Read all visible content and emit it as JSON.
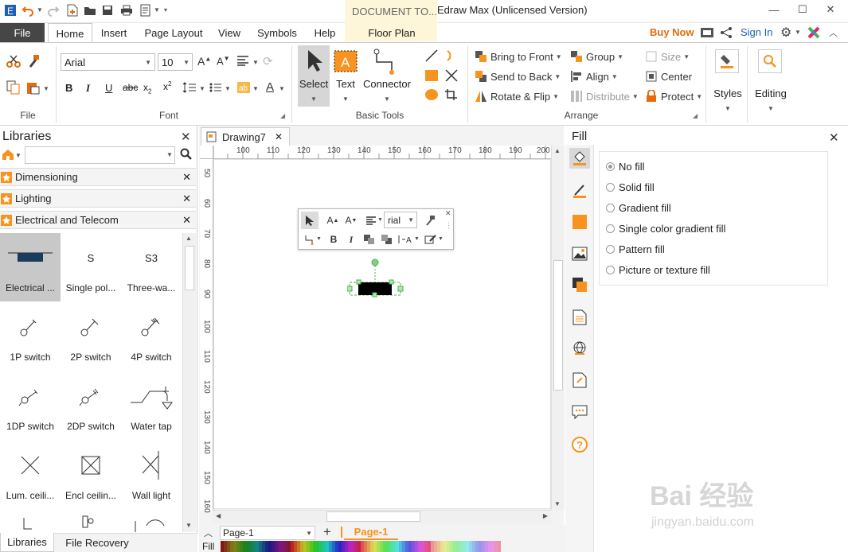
{
  "window": {
    "title": "Edraw Max (Unlicensed Version)",
    "context_tab": "DOCUMENT TO...",
    "controls": {
      "minimize": "—",
      "maximize": "☐",
      "close": "✕"
    }
  },
  "menu": {
    "file_tab": "File",
    "tabs": [
      "Home",
      "Insert",
      "Page Layout",
      "View",
      "Symbols",
      "Help",
      "Floor Plan"
    ],
    "buy_now": "Buy Now",
    "sign_in": "Sign In"
  },
  "ribbon": {
    "groups": {
      "file": "File",
      "font": "Font",
      "basic_tools": "Basic Tools",
      "arrange": "Arrange"
    },
    "font_name": "Arial",
    "font_size": "10",
    "tools": {
      "select": "Select",
      "text": "Text",
      "connector": "Connector"
    },
    "arrange": {
      "bring_to_front": "Bring to Front",
      "send_to_back": "Send to Back",
      "rotate_flip": "Rotate & Flip",
      "group": "Group",
      "align": "Align",
      "distribute": "Distribute",
      "size": "Size",
      "center": "Center",
      "protect": "Protect"
    },
    "styles": "Styles",
    "editing": "Editing"
  },
  "libraries": {
    "title": "Libraries",
    "search_value": "",
    "categories": [
      "Dimensioning",
      "Lighting",
      "Electrical and Telecom"
    ],
    "shapes": [
      {
        "label": "Electrical ...",
        "icon": "electrical-panel-icon",
        "glyph": ""
      },
      {
        "label": "Single pol...",
        "icon": "single-pole-icon",
        "glyph": "S"
      },
      {
        "label": "Three-wa...",
        "icon": "three-way-icon",
        "glyph": "S3"
      },
      {
        "label": "1P switch",
        "icon": "1p-switch-icon",
        "glyph": ""
      },
      {
        "label": "2P switch",
        "icon": "2p-switch-icon",
        "glyph": ""
      },
      {
        "label": "4P switch",
        "icon": "4p-switch-icon",
        "glyph": ""
      },
      {
        "label": "1DP switch",
        "icon": "1dp-switch-icon",
        "glyph": ""
      },
      {
        "label": "2DP switch",
        "icon": "2dp-switch-icon",
        "glyph": ""
      },
      {
        "label": "Water tap",
        "icon": "water-tap-icon",
        "glyph": ""
      },
      {
        "label": "Lum. ceili...",
        "icon": "lum-ceiling-icon",
        "glyph": ""
      },
      {
        "label": "Encl ceilin...",
        "icon": "encl-ceiling-icon",
        "glyph": ""
      },
      {
        "label": "Wall light",
        "icon": "wall-light-icon",
        "glyph": ""
      }
    ],
    "bottom_tabs": [
      "Libraries",
      "File Recovery"
    ]
  },
  "document": {
    "tab_name": "Drawing7",
    "ruler_h": [
      "100",
      "110",
      "120",
      "130",
      "140",
      "150",
      "160",
      "170",
      "180",
      "190",
      "200"
    ],
    "ruler_v": [
      "50",
      "60",
      "70",
      "80",
      "90",
      "100",
      "110",
      "120",
      "130",
      "140",
      "150",
      "160"
    ],
    "page_select": "Page-1",
    "page_tab": "Page-1",
    "fill_label": "Fill",
    "float_font": "rial"
  },
  "fill_panel": {
    "title": "Fill",
    "options": [
      "No fill",
      "Solid fill",
      "Gradient fill",
      "Single color gradient fill",
      "Pattern fill",
      "Picture or texture fill"
    ],
    "selected": "No fill"
  },
  "colors": {
    "accent_orange": "#f7931e",
    "buy_now": "#e46c0a",
    "sign_in": "#1f5fb4",
    "file_tab": "#464646",
    "page_tab": "#f7931e",
    "selection_green": "#4caf50"
  },
  "watermark": {
    "brand": "Bai 经验",
    "url": "jingyan.baidu.com"
  }
}
